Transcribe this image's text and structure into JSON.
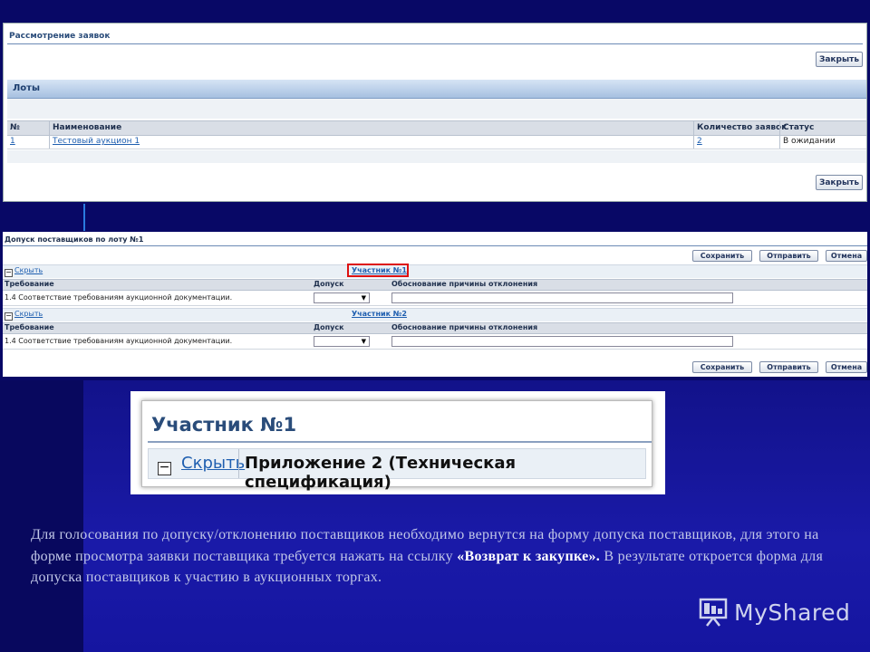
{
  "panel1": {
    "title": "Рассмотрение заявок",
    "close_button": "Закрыть",
    "lots_section": "Лоты",
    "columns": [
      "№",
      "Наименование",
      "Количество заявок",
      "Статус"
    ],
    "rows": [
      {
        "num": "1",
        "name": "Тестовый аукцион 1",
        "count": "2",
        "status": "В ожидании"
      }
    ]
  },
  "panel2": {
    "title": "Допуск поставщиков по лоту №1",
    "buttons": {
      "save": "Сохранить",
      "send": "Отправить",
      "cancel": "Отмена"
    },
    "participants": [
      {
        "hide_link": "Скрыть",
        "participant_link": "Участник №1",
        "columns": [
          "Требование",
          "Допуск",
          "Обоснование причины отклонения"
        ],
        "requirement": "1.4 Соответствие требованиям аукционной документации."
      },
      {
        "hide_link": "Скрыть",
        "participant_link": "Участник №2",
        "columns": [
          "Требование",
          "Допуск",
          "Обоснование причины отклонения"
        ],
        "requirement": "1.4 Соответствие требованиям аукционной документации."
      }
    ]
  },
  "zoom": {
    "title": "Участник №1",
    "hide_link": "Скрыть",
    "section": "Приложение 2 (Техническая спецификация)"
  },
  "paragraph": {
    "text_before": "Для голосования по допуску/отклонению поставщиков необходимо вернутся на форму допуска поставщиков, для этого на форме просмотра заявки поставщика требуется нажать на ссылку ",
    "bold": "«Возврат к закупке».",
    "text_after": " В результате откроется форма для допуска поставщиков к участию в аукционных торгах."
  },
  "watermark": {
    "brand": "MyShared",
    "icon": "presentation-board-icon"
  },
  "colors": {
    "link": "#1f5fb0",
    "header_bar": "#a6c0e0",
    "highlight": "#d11111",
    "background": "#0c0c78"
  }
}
